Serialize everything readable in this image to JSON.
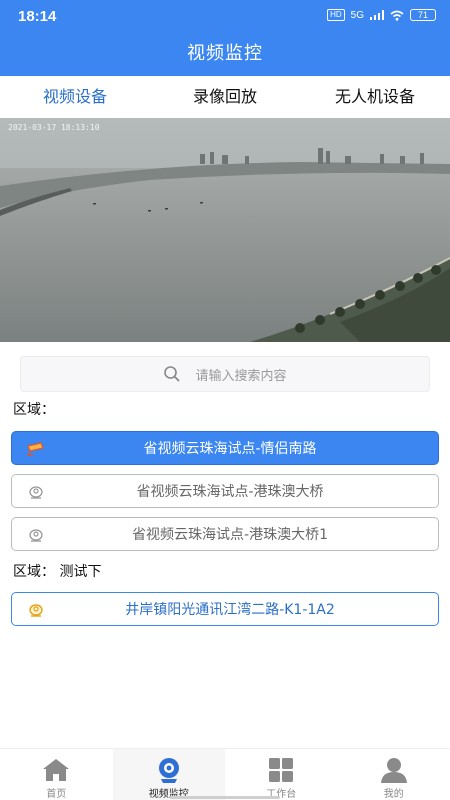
{
  "status_bar": {
    "time": "18:14",
    "network": "5G",
    "battery": "71",
    "hd": "HD"
  },
  "header": {
    "title": "视频监控"
  },
  "tabs": [
    {
      "label": "视频设备",
      "active": true
    },
    {
      "label": "录像回放",
      "active": false
    },
    {
      "label": "无人机设备",
      "active": false
    }
  ],
  "video": {
    "timestamp": "2021-03-17 18:13:10"
  },
  "search": {
    "placeholder": "请输入搜索内容",
    "icon": "search-icon"
  },
  "regions": [
    {
      "label": "区域：",
      "sites": [
        {
          "label": "省视频云珠海试点-情侣南路",
          "state": "selected",
          "icon": "camera-icon"
        },
        {
          "label": "省视频云珠海试点-港珠澳大桥",
          "state": "normal",
          "icon": "camera-icon"
        },
        {
          "label": "省视频云珠海试点-港珠澳大桥1",
          "state": "normal",
          "icon": "camera-icon"
        }
      ]
    },
    {
      "label": "区域：  测试下",
      "sites": [
        {
          "label": "井岸镇阳光通讯江湾二路-K1-1A2",
          "state": "outline",
          "icon": "camera-icon"
        }
      ]
    }
  ],
  "bottom_nav": [
    {
      "label": "首页",
      "icon": "home-icon",
      "active": false
    },
    {
      "label": "视频监控",
      "icon": "camera-icon",
      "active": true
    },
    {
      "label": "工作台",
      "icon": "grid-icon",
      "active": false
    },
    {
      "label": "我的",
      "icon": "user-icon",
      "active": false
    }
  ],
  "colors": {
    "primary": "#3b86f0",
    "active_text": "#2a6fc9"
  }
}
